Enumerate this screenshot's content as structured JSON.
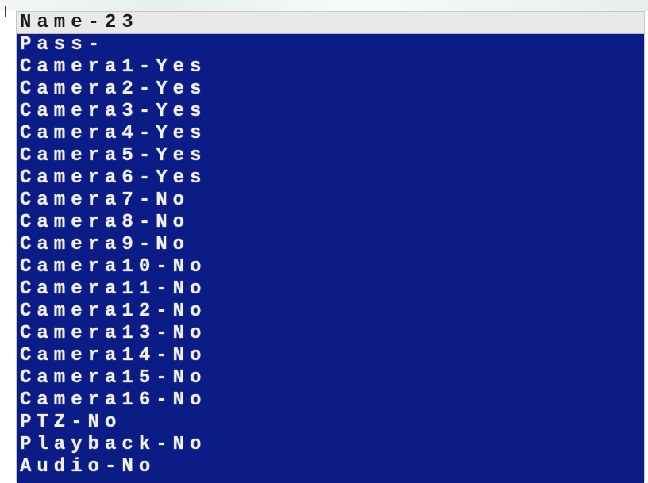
{
  "menu": {
    "title": "Name-23",
    "items": [
      {
        "label": "Pass-"
      },
      {
        "label": "Camera1-Yes"
      },
      {
        "label": "Camera2-Yes"
      },
      {
        "label": "Camera3-Yes"
      },
      {
        "label": "Camera4-Yes"
      },
      {
        "label": "Camera5-Yes"
      },
      {
        "label": "Camera6-Yes"
      },
      {
        "label": "Camera7-No"
      },
      {
        "label": "Camera8-No"
      },
      {
        "label": "Camera9-No"
      },
      {
        "label": "Camera10-No"
      },
      {
        "label": "Camera11-No"
      },
      {
        "label": "Camera12-No"
      },
      {
        "label": "Camera13-No"
      },
      {
        "label": "Camera14-No"
      },
      {
        "label": "Camera15-No"
      },
      {
        "label": "Camera16-No"
      },
      {
        "label": "PTZ-No"
      },
      {
        "label": "Playback-No"
      },
      {
        "label": "Audio-No"
      }
    ]
  },
  "colors": {
    "list_background": "#0b1c87",
    "item_text": "#f1f1f1",
    "title_background": "#e9e9e9",
    "title_text": "#1a1a1a"
  }
}
